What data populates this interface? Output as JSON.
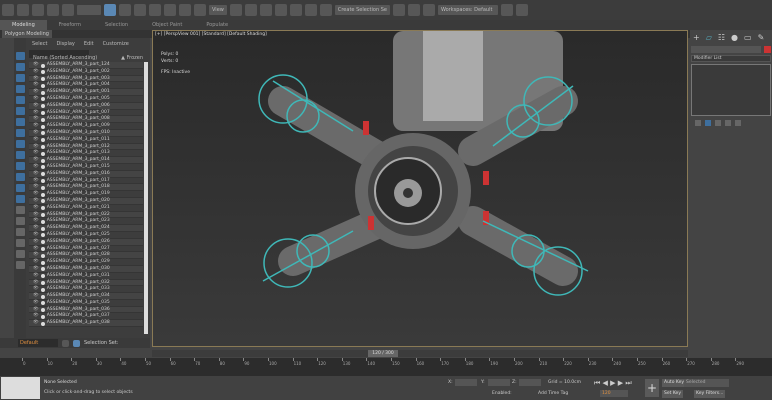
{
  "toolbar": {
    "view_dropdown": "View",
    "selection_set": "Create Selection Se",
    "workspace": "Workspaces: Default",
    "icons": [
      "undo-icon",
      "redo-icon",
      "link-icon",
      "unlink-icon",
      "bind-spacewarp-icon",
      "select-icon",
      "select-by-name-icon",
      "rect-select-icon",
      "window-crossing-icon",
      "move-icon",
      "rotate-icon",
      "scale-icon",
      "place-icon",
      "snap-icon",
      "angle-snap-icon",
      "percent-snap-icon",
      "spinner-snap-icon",
      "mirror-icon",
      "align-icon",
      "layer-icon",
      "graph-editor-icon",
      "material-editor-icon",
      "render-setup-icon",
      "render-icon"
    ]
  },
  "ribbon": {
    "tabs": [
      "Modeling",
      "Freeform",
      "Selection",
      "Object Paint",
      "Populate"
    ],
    "active": "Modeling",
    "sub": "Polygon Modeling"
  },
  "outliner": {
    "menu": [
      "Select",
      "Display",
      "Edit",
      "Customize"
    ],
    "column_name": "Name (Sorted Ascending)",
    "column_frozen": "▲ Frozen",
    "items": [
      "ASSEMBLY_ARM_3_part_124",
      "ASSEMBLY_ARM_3_part_002",
      "ASSEMBLY_ARM_3_part_003",
      "ASSEMBLY_ARM_3_part_004",
      "ASSEMBLY_ARM_3_part_001",
      "ASSEMBLY_ARM_3_part_005",
      "ASSEMBLY_ARM_3_part_006",
      "ASSEMBLY_ARM_3_part_007",
      "ASSEMBLY_ARM_3_part_008",
      "ASSEMBLY_ARM_3_part_009",
      "ASSEMBLY_ARM_3_part_010",
      "ASSEMBLY_ARM_3_part_011",
      "ASSEMBLY_ARM_3_part_012",
      "ASSEMBLY_ARM_3_part_013",
      "ASSEMBLY_ARM_3_part_014",
      "ASSEMBLY_ARM_3_part_015",
      "ASSEMBLY_ARM_3_part_016",
      "ASSEMBLY_ARM_3_part_017",
      "ASSEMBLY_ARM_3_part_018",
      "ASSEMBLY_ARM_3_part_019",
      "ASSEMBLY_ARM_3_part_020",
      "ASSEMBLY_ARM_3_part_021",
      "ASSEMBLY_ARM_3_part_022",
      "ASSEMBLY_ARM_3_part_023",
      "ASSEMBLY_ARM_3_part_024",
      "ASSEMBLY_ARM_3_part_025",
      "ASSEMBLY_ARM_3_part_026",
      "ASSEMBLY_ARM_3_part_027",
      "ASSEMBLY_ARM_3_part_028",
      "ASSEMBLY_ARM_3_part_029",
      "ASSEMBLY_ARM_3_part_030",
      "ASSEMBLY_ARM_3_part_031",
      "ASSEMBLY_ARM_3_part_032",
      "ASSEMBLY_ARM_3_part_033",
      "ASSEMBLY_ARM_3_part_034",
      "ASSEMBLY_ARM_3_part_035",
      "ASSEMBLY_ARM_3_part_036",
      "ASSEMBLY_ARM_3_part_037",
      "ASSEMBLY_ARM_3_part_038"
    ],
    "layer": "Default",
    "selection_set": "Selection Set:"
  },
  "viewport": {
    "label": "[+] [PerspView 001] [Standard] [Default Shading]",
    "polys_label": "Polys:",
    "polys": "0",
    "verts_label": "Verts:",
    "verts": "0",
    "fps_label": "FPS:",
    "fps": "Inactive",
    "accent": "#3fb8b8"
  },
  "command_panel": {
    "modifier_list": "Modifier List",
    "name_color": "#cc3333"
  },
  "timeline": {
    "frame": "120 / 300",
    "ticks": [
      "0",
      "10",
      "20",
      "30",
      "40",
      "50",
      "60",
      "70",
      "80",
      "90",
      "100",
      "110",
      "120",
      "130",
      "140",
      "150",
      "160",
      "170",
      "180",
      "190",
      "200",
      "210",
      "220",
      "230",
      "240",
      "250",
      "260",
      "270",
      "280",
      "290"
    ]
  },
  "status": {
    "selection": "None Selected",
    "prompt": "Click or click-and-drag to select objects",
    "x_label": "X:",
    "y_label": "Y:",
    "z_label": "Z:",
    "grid": "Grid = 10.0cm",
    "add_time_tag": "Add Time Tag",
    "auto_key": "Auto Key",
    "set_key": "Set Key",
    "key_mode": "Selected",
    "key_filters": "Key Filters...",
    "current_frame": "120",
    "isolate_label": "Enabled:"
  }
}
